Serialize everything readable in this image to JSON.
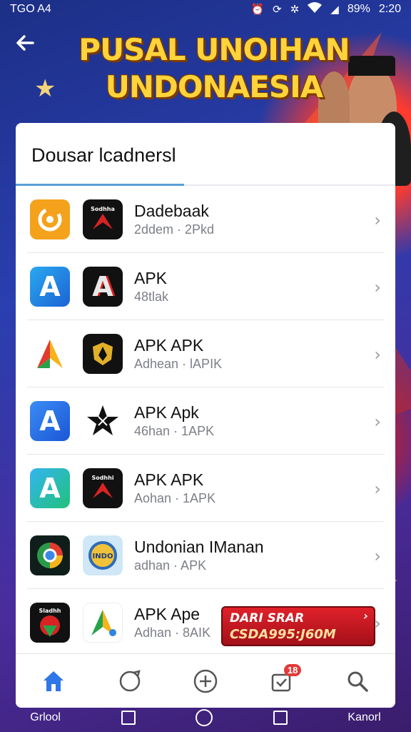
{
  "status_bar": {
    "left_text": "TGO A4",
    "battery": "89%",
    "time": "2:20"
  },
  "banner": {
    "title_line1": "PUSAL UNOIHAN",
    "title_line2": "UNDONAESIA"
  },
  "card": {
    "header": "Dousar lcadnersl",
    "items": [
      {
        "name": "Dadebaak",
        "sub": "2ddem · 2Pkd",
        "icon1": "swirl-app-icon",
        "icon2": "red-emblem-app-icon",
        "icon2_text": "Sodhha"
      },
      {
        "name": "APK",
        "sub": "48tlak",
        "icon1": "letter-a-app-icon",
        "icon2": "letter-a-dark-app-icon",
        "icon1_text": "A",
        "icon2_text": "A"
      },
      {
        "name": "APK APK",
        "sub": "Adhean · lAPIK",
        "icon1": "play-triangle-app-icon",
        "icon2": "shield-app-icon"
      },
      {
        "name": "APK Apk",
        "sub": "46han · 1APK",
        "icon1": "app-store-a-icon",
        "icon2": "star-badge-icon",
        "icon1_text": "A"
      },
      {
        "name": "APK APK",
        "sub": "Aohan · 1APK",
        "icon1": "letter-a-app-icon",
        "icon2": "red-emblem-app-icon",
        "icon1_text": "A",
        "icon2_text": "Sodhhi"
      },
      {
        "name": "Undonian IManan",
        "sub": "adhan · APK",
        "icon1": "chrome-like-app-icon",
        "icon2": "badge-app-icon",
        "icon2_text": "INDO"
      },
      {
        "name": "APK Ape",
        "sub": "Adhan · 8AIK",
        "icon1": "red-emblem-app-icon",
        "icon2": "play-triangle-app-icon",
        "icon1_text": "Sladhh"
      }
    ]
  },
  "promo": {
    "line1": "DARI SRAR",
    "line2": "CSDA995:J60M"
  },
  "tabbar": {
    "badge": "18"
  },
  "navbar": {
    "left_label": "Grlool",
    "right_label": "Kanorl"
  },
  "colors": {
    "accent_underline": "#5aa0d8",
    "banner_title": "#ffd33a",
    "promo": "#e0212a",
    "tab_active": "#2f76e6"
  }
}
